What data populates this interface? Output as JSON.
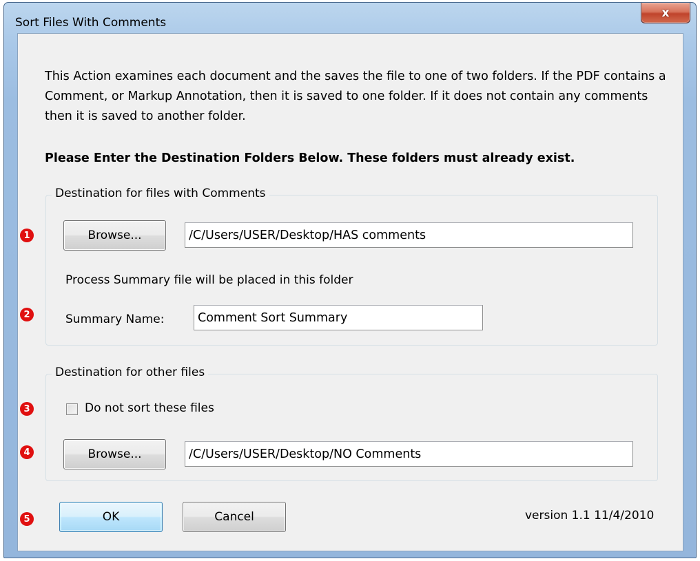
{
  "window": {
    "title": "Sort Files With Comments",
    "close_glyph": "x"
  },
  "description": "This Action examines each document and the saves the file to one of two folders.  If the PDF contains a Comment, or Markup Annotation, then it is saved to one folder. If it does not contain any comments then it is saved to another folder.",
  "heading": "Please Enter the Destination Folders Below.  These folders must already exist.",
  "group_comments": {
    "label": "Destination for files with Comments",
    "browse_label": "Browse...",
    "path_value": "/C/Users/USER/Desktop/HAS comments",
    "summary_note": "Process Summary file will be placed in this folder",
    "summary_label": "Summary Name:",
    "summary_value": "Comment Sort Summary"
  },
  "group_other": {
    "label": "Destination for other files",
    "checkbox_label": "Do not sort these files",
    "checkbox_checked": false,
    "browse_label": "Browse...",
    "path_value": "/C/Users/USER/Desktop/NO Comments"
  },
  "footer": {
    "ok_label": "OK",
    "cancel_label": "Cancel",
    "version": "version 1.1  11/4/2010"
  },
  "markers": [
    "1",
    "2",
    "3",
    "4",
    "5"
  ],
  "colors": {
    "marker_red": "#e01010",
    "titlebar_blue": "#a9c8e8",
    "close_red": "#c0442c",
    "dialog_bg": "#f0f0f0"
  }
}
